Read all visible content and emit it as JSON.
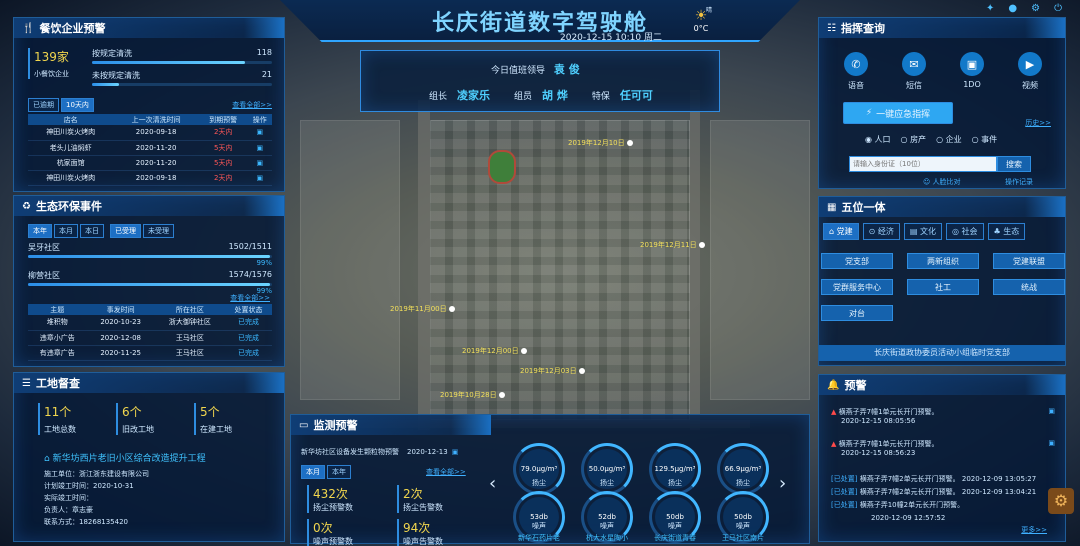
{
  "header": {
    "title": "长庆街道数字驾驶舱",
    "datetime": "2020-12-15 10:10 周二",
    "weather": {
      "condition": "晴",
      "temp": "0°C"
    }
  },
  "duty": {
    "leader_label": "今日值班领导",
    "leader": "袁 俊",
    "group_label": "组长",
    "group": "凌家乐",
    "member_label": "组员",
    "member": "胡 烨",
    "special_label": "特保",
    "special": "任可可"
  },
  "catering": {
    "title": "餐饮企业预警",
    "count": "139家",
    "count_label": "小餐饮企业",
    "items": [
      {
        "label": "按规定清洗",
        "value": "118",
        "pct": 0.85
      },
      {
        "label": "未按规定清洗",
        "value": "21",
        "pct": 0.15
      }
    ],
    "tabs": [
      "已逾期",
      "10天内"
    ],
    "more": "查看全部>>",
    "columns": [
      "店名",
      "上一次清洗时间",
      "到期预警",
      "操作"
    ],
    "rows": [
      [
        "神田川炭火烤肉",
        "2020-09-18",
        "2天内"
      ],
      [
        "老头儿油焖虾",
        "2020-11-20",
        "5天内"
      ],
      [
        "杭家面馆",
        "2020-11-20",
        "5天内"
      ],
      [
        "神田川炭火烤肉",
        "2020-09-18",
        "2天内"
      ]
    ]
  },
  "eco": {
    "title": "生态环保事件",
    "tabs": [
      "本年",
      "本月",
      "本日"
    ],
    "status_tabs": [
      "已受理",
      "未受理"
    ],
    "bars": [
      {
        "label": "吴牙社区",
        "value": "1502/1511",
        "pct_text": "99%",
        "pct": 0.99
      },
      {
        "label": "柳营社区",
        "value": "1574/1576",
        "pct_text": "99%",
        "pct": 0.99
      }
    ],
    "more": "查看全部>>",
    "columns": [
      "主题",
      "事发时间",
      "所在社区",
      "处置状态"
    ],
    "rows": [
      [
        "堆积物",
        "2020-10-23",
        "浙大御钟社区",
        "已完成"
      ],
      [
        "违章小广告",
        "2020-12-08",
        "王马社区",
        "已完成"
      ],
      [
        "有违章广告",
        "2020-11-25",
        "王马社区",
        "已完成"
      ]
    ]
  },
  "construction": {
    "title": "工地督查",
    "stats": [
      {
        "value": "11个",
        "label": "工地总数"
      },
      {
        "value": "6个",
        "label": "旧改工地"
      },
      {
        "value": "5个",
        "label": "在建工地"
      }
    ],
    "project": {
      "name": "新华坊西片老旧小区综合改造提升工程",
      "fields": [
        {
          "k": "施工单位：",
          "v": "浙江浙东建设有限公司"
        },
        {
          "k": "计划竣工时间：",
          "v": "2020-10-31"
        },
        {
          "k": "实际竣工时间：",
          "v": ""
        },
        {
          "k": "负责人：",
          "v": "章志豪"
        },
        {
          "k": "联系方式：",
          "v": "18268135420"
        }
      ]
    }
  },
  "monitor": {
    "title": "监测预警",
    "notice": "新华坊社区设备发生颗粒物预警",
    "notice_date": "2020-12-13",
    "tabs": [
      "本月",
      "本年"
    ],
    "more": "查看全部>>",
    "stats": [
      {
        "value": "432次",
        "label": "扬尘预警数"
      },
      {
        "value": "2次",
        "label": "扬尘告警数"
      },
      {
        "value": "0次",
        "label": "噪声预警数"
      },
      {
        "value": "94次",
        "label": "噪声告警数"
      }
    ],
    "gauges": [
      {
        "value": "79.0μg/m³",
        "label": "扬尘"
      },
      {
        "value": "50.0μg/m³",
        "label": "扬尘"
      },
      {
        "value": "129.5μg/m³",
        "label": "扬尘"
      },
      {
        "value": "66.9μg/m³",
        "label": "扬尘"
      },
      {
        "value": "53db",
        "label": "噪声"
      },
      {
        "value": "52db",
        "label": "噪声"
      },
      {
        "value": "50db",
        "label": "噪声"
      },
      {
        "value": "50db",
        "label": "噪声"
      }
    ],
    "sites": [
      "新华石药片老",
      "杭大水星陶小",
      "长庆街道青春",
      "王马社区南片"
    ]
  },
  "command": {
    "title": "指挥查询",
    "actions": [
      {
        "label": "语音",
        "icon": "phone-icon"
      },
      {
        "label": "短信",
        "icon": "message-icon"
      },
      {
        "label": "1DO",
        "icon": "image-icon"
      },
      {
        "label": "视频",
        "icon": "video-icon"
      }
    ],
    "emergency": "一键应急指挥",
    "history": "历史>>",
    "radios": [
      "人口",
      "房产",
      "企业",
      "事件"
    ],
    "search_placeholder": "请输入身份证（10位）",
    "search_btn": "搜索",
    "face": "人脸比对",
    "log": "操作记录"
  },
  "five": {
    "title": "五位一体",
    "tabs": [
      "党建",
      "经济",
      "文化",
      "社会",
      "生态"
    ],
    "buttons": [
      "党支部",
      "两新组织",
      "党建联盟",
      "党群服务中心",
      "社工",
      "统战",
      "对台"
    ],
    "banner": "长庆街道政协委员活动小组临时党支部"
  },
  "alerts": {
    "title": "预警",
    "items": [
      {
        "text": "横燕子弄7幢1单元长开门预警。",
        "time": "2020-12-15 08:05:56"
      },
      {
        "text": "横燕子弄7幢1单元长开门预警。",
        "time": "2020-12-15 08:56:23"
      }
    ],
    "handled": [
      {
        "tag": "[已处置]",
        "text": "横燕子弄7幢2单元长开门预警。",
        "time": "2020-12-09 13:05:27"
      },
      {
        "tag": "[已处置]",
        "text": "横燕子弄7幢2单元长开门预警。",
        "time": "2020-12-09 13:04:21"
      },
      {
        "tag": "[已处置]",
        "text": "横燕子弄10幢2单元长开门预警。",
        "time": "2020-12-09 12:57:52"
      }
    ],
    "more": "更多>>"
  },
  "map_pins": [
    "2019年12月10日",
    "2019年12月11日",
    "2019年11月00日",
    "2019年12月00日",
    "2019年12月03日",
    "2019年10月28日"
  ]
}
